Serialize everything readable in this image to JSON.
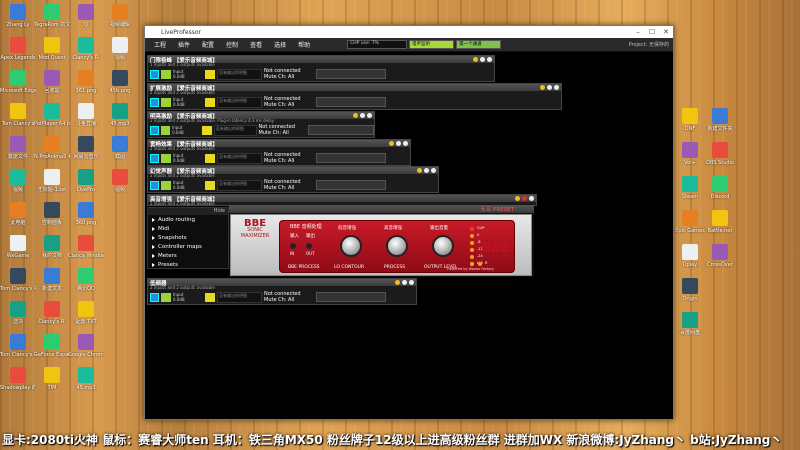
{
  "app": {
    "window_title": "LiveProfessor",
    "menu": [
      "工程",
      "插件",
      "配置",
      "控制",
      "查看",
      "选择",
      "帮助"
    ],
    "cpu": "CHP use: 7%",
    "level_in": "电平监听",
    "level_out": "第一个通道",
    "project": "Project: 无保存的"
  },
  "racks": [
    {
      "name": "门限极峰 【爱乐音频商城】",
      "sub": "1 inputs and 1 outputs available",
      "input": "Input",
      "level": "0.0dB",
      "status": "Not connected",
      "mute": "Mute",
      "ch": "Ch: All",
      "screen": "没有输出的明细"
    },
    {
      "name": "扩展激励 【爱乐音频商城】",
      "sub": "2 inputs and 2 outputs available",
      "input": "Input",
      "level": "0.0dB",
      "status": "Not connected",
      "mute": "Mute",
      "ch": "Ch: All",
      "screen": "没有输出的明细"
    },
    {
      "name": "明亮激励 【爱乐音频商城】",
      "sub": "2 inputs and 2 outputs available. Plug-in latency 4.3 ms delay",
      "input": "Input",
      "level": "0.0dB",
      "status": "Not connected",
      "mute": "Mute",
      "ch": "Ch: All",
      "screen": "没有输出的明细"
    },
    {
      "name": "宽畅效果 【爱乐音频商城】",
      "sub": "2 inputs and 2 outputs available",
      "input": "Input",
      "level": "0.0dB",
      "status": "Not connected",
      "mute": "Mute",
      "ch": "Ch: All",
      "screen": "没有输出的明细"
    },
    {
      "name": "幻觉声器 【爱乐音频商城】",
      "sub": "2 inputs and 2 outputs available",
      "input": "Input",
      "level": "0.0dB",
      "status": "Not connected",
      "mute": "Mute",
      "ch": "Ch: All",
      "screen": "没有输出的明细"
    }
  ],
  "bbe_rack": {
    "name": "高音增强 【爱乐音频商城】",
    "sub": "2 inputs and 2 outputs available"
  },
  "last_rack": {
    "name": "低频器",
    "sub": "2 inputs and 2 outputs available",
    "input": "Input",
    "level": "0.0dB",
    "status": "Not connected",
    "mute": "Mute",
    "ch": "Ch: All",
    "screen": "没有输出的明细"
  },
  "sidebar": {
    "hide": "Hide",
    "items": [
      "Audio routing",
      "Midi",
      "Snapshots",
      "Controller maps",
      "Meters",
      "Presets"
    ]
  },
  "bbe": {
    "logo_top": "BBE",
    "logo_1": "SONIC",
    "logo_2": "MAXIMIZER",
    "title": "BBE 音频处理",
    "in_label": "输入",
    "out_label": "输出",
    "in_sw": "IN",
    "out_sw": "OUT",
    "proc_foot": "BBE PROCESS",
    "k1_top": "低音增强",
    "k1_foot": "LO CONTOUR",
    "k2_top": "高音增强",
    "k2_foot": "PROCESS",
    "k3_top": "输出音量",
    "k3_foot": "OUTPUT LEVEL",
    "brand": "BBE",
    "led_labels": [
      "CLIP",
      "0",
      "-6",
      "-12",
      "-24",
      "-48",
      "L",
      "R"
    ],
    "powered": "Powered by Waves Factory",
    "preset": "无名 PRESET"
  },
  "desktop_icons": [
    "Zhang Ly",
    "Apex Legends",
    "Microsoft Edge",
    "Tom Clancy's",
    "数据文件",
    "视频",
    "此电脑",
    "WeGame",
    "Tom Clancy's R.",
    "选项",
    "Tom Clancy's R.",
    "Shadowplay 的文件",
    "TegraRom 的文件",
    "Mod Quest",
    "回收站",
    "PotPlayer 64 bit",
    "N.ProAnimaS 程序",
    "无标题-1.txt",
    "控制面板",
    "我的文档",
    "新建文本",
    "Clancy's R.",
    "GeForce Experience",
    "TIM",
    "Q",
    "Clancy's R.",
    "361.png",
    "斗鱼直播",
    "网易云音乐",
    "LivePro",
    "360.png",
    "Clanca Windows",
    "腾讯QQ",
    "配置.TXT",
    "Google Chrome",
    "45.mp3",
    "视频编辑",
    "视频",
    "45b.png",
    "45.mp3",
    "截图",
    "视频"
  ],
  "right_icons": [
    "DNF",
    "Vol+",
    "Steam",
    "Epic Games",
    "Uplay",
    "Origin",
    "百度网盘",
    "新建文件夹",
    "OBS Studio",
    "Discord",
    "Battle.net",
    "CrossOver"
  ],
  "ticker": "显卡:2080ti火神  鼠标：赛睿大师ten 耳机：铁三角MX50  粉丝牌子12级以上进高级粉丝群  进群加WX  新浪微博:JyZhang丶  b站:JyZhang丶",
  "colors": {
    "accent": "#c81a28",
    "blue": "#2d8bd8",
    "green": "#9ad43a",
    "yellow": "#e8d820"
  }
}
